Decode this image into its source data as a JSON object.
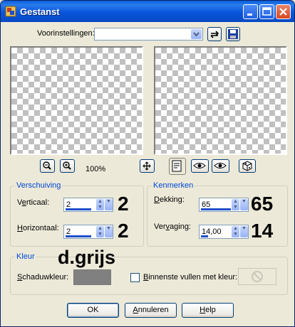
{
  "window": {
    "title": "Gestanst"
  },
  "presets": {
    "label": "Voorinstellingen:",
    "value": ""
  },
  "zoom": {
    "level": "100%"
  },
  "offset": {
    "title": "Verschuiving",
    "vertical": {
      "label": "Verticaal:",
      "value": "2",
      "annotation": "2"
    },
    "horizontal": {
      "label": "Horizontaal:",
      "value": "2",
      "annotation": "2"
    }
  },
  "properties": {
    "title": "Kenmerken",
    "opacity": {
      "label": "Dekking:",
      "value": "65",
      "annotation": "65"
    },
    "blur": {
      "label": "Vervaging:",
      "value": "14,00",
      "annotation": "14"
    }
  },
  "color": {
    "title": "Kleur",
    "annotation": "d.grijs",
    "shadow_label": "Schaduwkleur:",
    "shadow_color": "#808080",
    "fill_inside_label": "Binnenste vullen met kleur:",
    "fill_inside_checked": false
  },
  "buttons": {
    "ok": "OK",
    "cancel": "Annuleren",
    "help": "Help"
  },
  "icons": {
    "app": "app-icon",
    "minimize": "minimize-icon",
    "maximize": "maximize-icon",
    "close": "close-icon",
    "reset": "reset-icon",
    "save": "save-icon",
    "zoom_out": "zoom-out-icon",
    "zoom_in": "zoom-in-icon",
    "pan": "pan-icon",
    "proof": "proof-icon",
    "auto_proof": "auto-proof-icon",
    "preview": "preview-icon",
    "randomize": "randomize-icon"
  },
  "colors": {
    "titlebar": "#0855dd",
    "group_label": "#0046d5",
    "accent": "#2050c8"
  }
}
